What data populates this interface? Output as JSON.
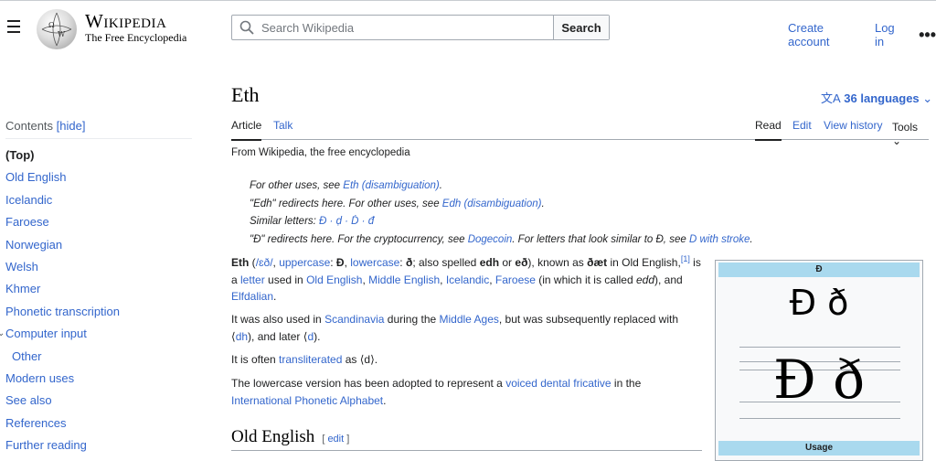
{
  "header": {
    "wordmark_main": "Wikipedia",
    "wordmark_tag": "The Free Encyclopedia",
    "search_placeholder": "Search Wikipedia",
    "search_button": "Search",
    "create_account": "Create account",
    "log_in": "Log in",
    "more": "•••"
  },
  "toc": {
    "label": "Contents",
    "hide": "[hide]",
    "items": [
      {
        "label": "(Top)"
      },
      {
        "label": "Old English"
      },
      {
        "label": "Icelandic"
      },
      {
        "label": "Faroese"
      },
      {
        "label": "Norwegian"
      },
      {
        "label": "Welsh"
      },
      {
        "label": "Khmer"
      },
      {
        "label": "Phonetic transcription"
      },
      {
        "label": "Computer input"
      },
      {
        "label": "Other"
      },
      {
        "label": "Modern uses"
      },
      {
        "label": "See also"
      },
      {
        "label": "References"
      },
      {
        "label": "Further reading"
      }
    ]
  },
  "article": {
    "title": "Eth",
    "languages": "36 languages",
    "tabs": {
      "article": "Article",
      "talk": "Talk",
      "read": "Read",
      "edit": "Edit",
      "history": "View history",
      "tools": "Tools"
    },
    "from": "From Wikipedia, the free encyclopedia",
    "hatnotes": {
      "h1_pre": "For other uses, see ",
      "h1_link": "Eth (disambiguation)",
      "h1_post": ".",
      "h2_pre": "\"Edh\" redirects here. For other uses, see ",
      "h2_link": "Edh (disambiguation)",
      "h2_post": ".",
      "h3_pre": "Similar letters: ",
      "h3_link": "Đ · ḍ · Ḋ · đ",
      "h4_pre": "\"Ð\" redirects here. For the cryptocurrency, see ",
      "h4_link1": "Dogecoin",
      "h4_mid": ". For letters that look similar to Ð, see ",
      "h4_link2": "D with stroke",
      "h4_post": "."
    },
    "p1": {
      "bold1": "Eth",
      "t1": " (",
      "ipa": "/ɛð/",
      "t2": ", ",
      "upper_link": "uppercase",
      "t3": ": ",
      "upper_glyph": "Ð",
      "t4": ", ",
      "lower_link": "lowercase",
      "t5": ": ",
      "lower_glyph": "ð",
      "t6": "; also spelled ",
      "edh": "edh",
      "t7": " or ",
      "eth2": "eð",
      "t8": "), known as ",
      "daet": "ðæt",
      "t9": " in Old English,",
      "ref": "[1]",
      "t10": " is a ",
      "letter": "letter",
      "t11": " used in ",
      "oe": "Old English",
      "t12": ", ",
      "me": "Middle English",
      "t13": ", ",
      "ic": "Icelandic",
      "t14": ", ",
      "fa": "Faroese",
      "t15": " (in which it is called ",
      "edd": "edd",
      "t16": "), and ",
      "elf": "Elfdalian",
      "t17": "."
    },
    "p2": {
      "t1": "It was also used in ",
      "scan": "Scandinavia",
      "t2": " during the ",
      "ma": "Middle Ages",
      "t3": ", but was subsequently replaced with ",
      "dh": "dh",
      "t4": "), and later ",
      "d": "d",
      "t5": ")."
    },
    "p3": {
      "t1": "It is often ",
      "tr": "transliterated",
      "t2": " as ⟨d⟩."
    },
    "p4": {
      "t1": "The lowercase version has been adopted to represent a ",
      "vdf": "voiced dental fricative",
      "t2": " in the ",
      "ipa": "International Phonetic Alphabet",
      "t3": "."
    },
    "section": "Old English",
    "section_edit": "edit"
  },
  "infobox": {
    "header": "Ð",
    "glyphs": "Ð ð",
    "glyphs_large": "Ð ð",
    "usage": "Usage"
  }
}
